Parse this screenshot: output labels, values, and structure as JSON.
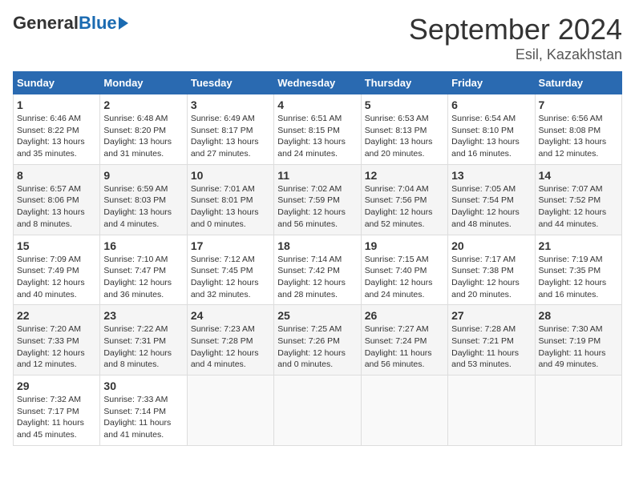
{
  "header": {
    "logo_general": "General",
    "logo_blue": "Blue",
    "title": "September 2024",
    "subtitle": "Esil, Kazakhstan"
  },
  "weekdays": [
    "Sunday",
    "Monday",
    "Tuesday",
    "Wednesday",
    "Thursday",
    "Friday",
    "Saturday"
  ],
  "weeks": [
    [
      {
        "day": 1,
        "sunrise": "6:46 AM",
        "sunset": "8:22 PM",
        "daylight": "13 hours and 35 minutes."
      },
      {
        "day": 2,
        "sunrise": "6:48 AM",
        "sunset": "8:20 PM",
        "daylight": "13 hours and 31 minutes."
      },
      {
        "day": 3,
        "sunrise": "6:49 AM",
        "sunset": "8:17 PM",
        "daylight": "13 hours and 27 minutes."
      },
      {
        "day": 4,
        "sunrise": "6:51 AM",
        "sunset": "8:15 PM",
        "daylight": "13 hours and 24 minutes."
      },
      {
        "day": 5,
        "sunrise": "6:53 AM",
        "sunset": "8:13 PM",
        "daylight": "13 hours and 20 minutes."
      },
      {
        "day": 6,
        "sunrise": "6:54 AM",
        "sunset": "8:10 PM",
        "daylight": "13 hours and 16 minutes."
      },
      {
        "day": 7,
        "sunrise": "6:56 AM",
        "sunset": "8:08 PM",
        "daylight": "13 hours and 12 minutes."
      }
    ],
    [
      {
        "day": 8,
        "sunrise": "6:57 AM",
        "sunset": "8:06 PM",
        "daylight": "13 hours and 8 minutes."
      },
      {
        "day": 9,
        "sunrise": "6:59 AM",
        "sunset": "8:03 PM",
        "daylight": "13 hours and 4 minutes."
      },
      {
        "day": 10,
        "sunrise": "7:01 AM",
        "sunset": "8:01 PM",
        "daylight": "13 hours and 0 minutes."
      },
      {
        "day": 11,
        "sunrise": "7:02 AM",
        "sunset": "7:59 PM",
        "daylight": "12 hours and 56 minutes."
      },
      {
        "day": 12,
        "sunrise": "7:04 AM",
        "sunset": "7:56 PM",
        "daylight": "12 hours and 52 minutes."
      },
      {
        "day": 13,
        "sunrise": "7:05 AM",
        "sunset": "7:54 PM",
        "daylight": "12 hours and 48 minutes."
      },
      {
        "day": 14,
        "sunrise": "7:07 AM",
        "sunset": "7:52 PM",
        "daylight": "12 hours and 44 minutes."
      }
    ],
    [
      {
        "day": 15,
        "sunrise": "7:09 AM",
        "sunset": "7:49 PM",
        "daylight": "12 hours and 40 minutes."
      },
      {
        "day": 16,
        "sunrise": "7:10 AM",
        "sunset": "7:47 PM",
        "daylight": "12 hours and 36 minutes."
      },
      {
        "day": 17,
        "sunrise": "7:12 AM",
        "sunset": "7:45 PM",
        "daylight": "12 hours and 32 minutes."
      },
      {
        "day": 18,
        "sunrise": "7:14 AM",
        "sunset": "7:42 PM",
        "daylight": "12 hours and 28 minutes."
      },
      {
        "day": 19,
        "sunrise": "7:15 AM",
        "sunset": "7:40 PM",
        "daylight": "12 hours and 24 minutes."
      },
      {
        "day": 20,
        "sunrise": "7:17 AM",
        "sunset": "7:38 PM",
        "daylight": "12 hours and 20 minutes."
      },
      {
        "day": 21,
        "sunrise": "7:19 AM",
        "sunset": "7:35 PM",
        "daylight": "12 hours and 16 minutes."
      }
    ],
    [
      {
        "day": 22,
        "sunrise": "7:20 AM",
        "sunset": "7:33 PM",
        "daylight": "12 hours and 12 minutes."
      },
      {
        "day": 23,
        "sunrise": "7:22 AM",
        "sunset": "7:31 PM",
        "daylight": "12 hours and 8 minutes."
      },
      {
        "day": 24,
        "sunrise": "7:23 AM",
        "sunset": "7:28 PM",
        "daylight": "12 hours and 4 minutes."
      },
      {
        "day": 25,
        "sunrise": "7:25 AM",
        "sunset": "7:26 PM",
        "daylight": "12 hours and 0 minutes."
      },
      {
        "day": 26,
        "sunrise": "7:27 AM",
        "sunset": "7:24 PM",
        "daylight": "11 hours and 56 minutes."
      },
      {
        "day": 27,
        "sunrise": "7:28 AM",
        "sunset": "7:21 PM",
        "daylight": "11 hours and 53 minutes."
      },
      {
        "day": 28,
        "sunrise": "7:30 AM",
        "sunset": "7:19 PM",
        "daylight": "11 hours and 49 minutes."
      }
    ],
    [
      {
        "day": 29,
        "sunrise": "7:32 AM",
        "sunset": "7:17 PM",
        "daylight": "11 hours and 45 minutes."
      },
      {
        "day": 30,
        "sunrise": "7:33 AM",
        "sunset": "7:14 PM",
        "daylight": "11 hours and 41 minutes."
      },
      null,
      null,
      null,
      null,
      null
    ]
  ]
}
